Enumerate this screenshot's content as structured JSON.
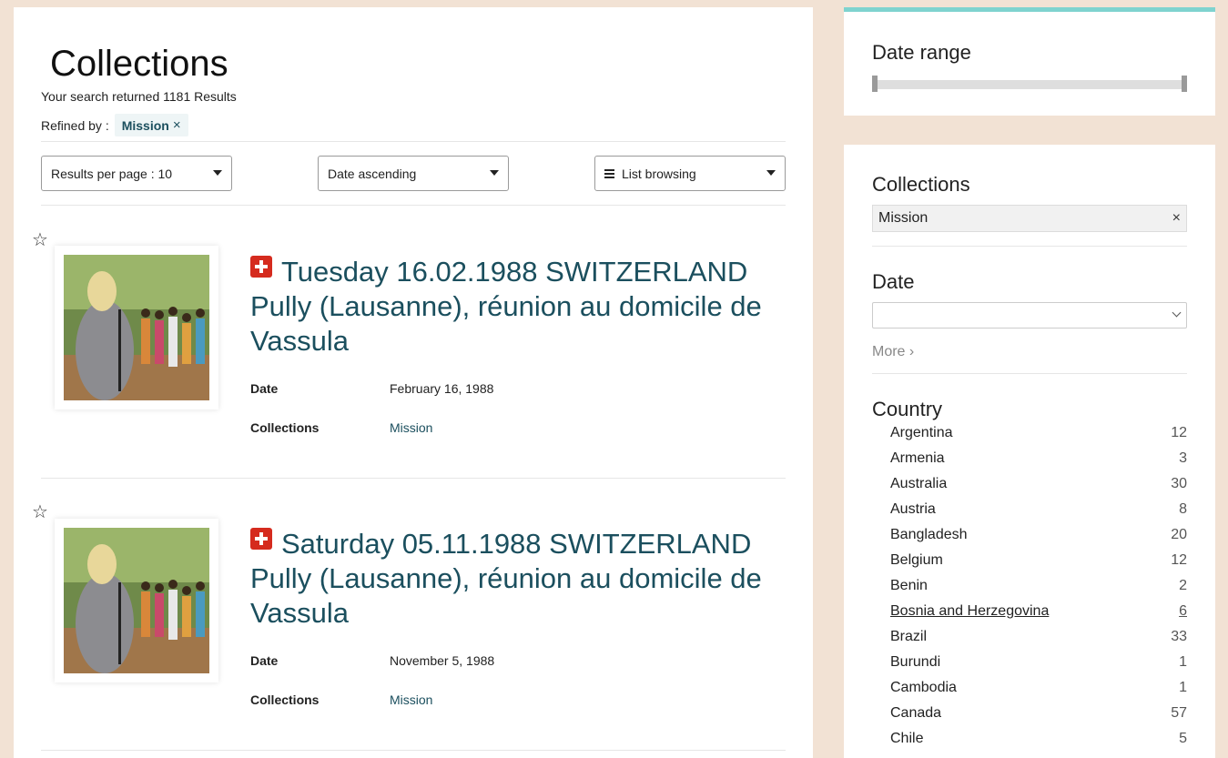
{
  "main": {
    "title": "Collections",
    "result_count": "Your search returned 1181 Results",
    "refined_label": "Refined by :",
    "refined_chip": "Mission",
    "refined_chip_remove": "×"
  },
  "toolbar": {
    "per_page": "Results per page : 10",
    "sort": "Date ascending",
    "view": "List browsing"
  },
  "items": [
    {
      "title": "Tuesday 16.02.1988 SWITZERLAND Pully (Lausanne), réunion au domicile de Vassula",
      "date_label": "Date",
      "date": "February 16, 1988",
      "collections_label": "Collections",
      "collection": "Mission"
    },
    {
      "title": "Saturday 05.11.1988 SWITZERLAND Pully (Lausanne), réunion au domicile de Vassula",
      "date_label": "Date",
      "date": "November 5, 1988",
      "collections_label": "Collections",
      "collection": "Mission"
    }
  ],
  "sidebar": {
    "date_range_title": "Date range",
    "collections_title": "Collections",
    "collections_chip": "Mission",
    "collections_chip_remove": "×",
    "date_title": "Date",
    "more": "More ›",
    "country_title": "Country",
    "countries": [
      {
        "name": "Argentina",
        "count": "12"
      },
      {
        "name": "Armenia",
        "count": "3"
      },
      {
        "name": "Australia",
        "count": "30"
      },
      {
        "name": "Austria",
        "count": "8"
      },
      {
        "name": "Bangladesh",
        "count": "20"
      },
      {
        "name": "Belgium",
        "count": "12"
      },
      {
        "name": "Benin",
        "count": "2"
      },
      {
        "name": "Bosnia and Herzegovina",
        "count": "6"
      },
      {
        "name": "Brazil",
        "count": "33"
      },
      {
        "name": "Burundi",
        "count": "1"
      },
      {
        "name": "Cambodia",
        "count": "1"
      },
      {
        "name": "Canada",
        "count": "57"
      },
      {
        "name": "Chile",
        "count": "5"
      }
    ]
  },
  "colors": {
    "accent": "#1b4f5e",
    "page_bg": "#f2e2d4",
    "sidebar_top_border": "#7fd3cf",
    "swiss_red": "#d52b1e"
  }
}
